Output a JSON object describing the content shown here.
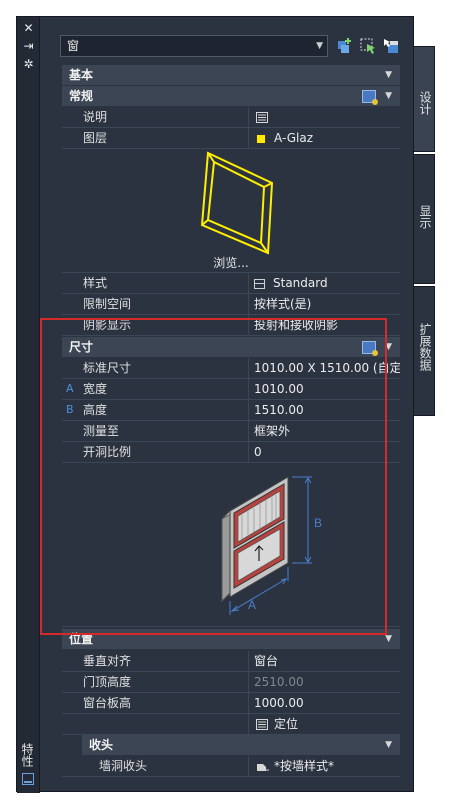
{
  "palette": {
    "panel": "#2b3340",
    "header": "#3c4554",
    "selection": "#d52a2a",
    "layer_swatch": "#ffea00"
  },
  "left_strip": {
    "title": "特性",
    "icons": [
      "close-icon",
      "auto-hide-icon",
      "options-icon",
      "properties-icon"
    ]
  },
  "object_type": "窗",
  "toolbar_icons": [
    "quick-select-add-icon",
    "select-objects-icon",
    "toggle-pickadd-icon"
  ],
  "side_tabs": [
    "设计",
    "显示",
    "扩展数据"
  ],
  "sections": {
    "basic": "基本",
    "general": "常规",
    "dimensions": "尺寸",
    "location": "位置",
    "finish": "收头"
  },
  "general_rows": [
    {
      "key": "说明",
      "value": ""
    },
    {
      "key": "图层",
      "value": "A-Glaz"
    }
  ],
  "browse_label": "浏览...",
  "style_rows": [
    {
      "key": "样式",
      "value": "Standard"
    },
    {
      "key": "限制空间",
      "value": "按样式(是)"
    },
    {
      "key": "阴影显示",
      "value": "投射和接收阴影"
    }
  ],
  "dim_rows": [
    {
      "key": "标准尺寸",
      "value": "1010.00  X  1510.00 (自定..."
    },
    {
      "key": "宽度",
      "value": "1010.00",
      "mark": "A"
    },
    {
      "key": "高度",
      "value": "1510.00",
      "mark": "B"
    },
    {
      "key": "测量至",
      "value": "框架外"
    },
    {
      "key": "开洞比例",
      "value": "0"
    }
  ],
  "diagram_labels": {
    "a": "A",
    "b": "B"
  },
  "location_rows": [
    {
      "key": "垂直对齐",
      "value": "窗台",
      "dim": false
    },
    {
      "key": "门顶高度",
      "value": "2510.00",
      "dim": true
    },
    {
      "key": "窗台板高",
      "value": "1000.00",
      "dim": false
    },
    {
      "key": "",
      "value": "定位",
      "dim": false
    }
  ],
  "finish_rows": [
    {
      "key": "墙洞收头",
      "value": "*按墙样式*"
    }
  ]
}
